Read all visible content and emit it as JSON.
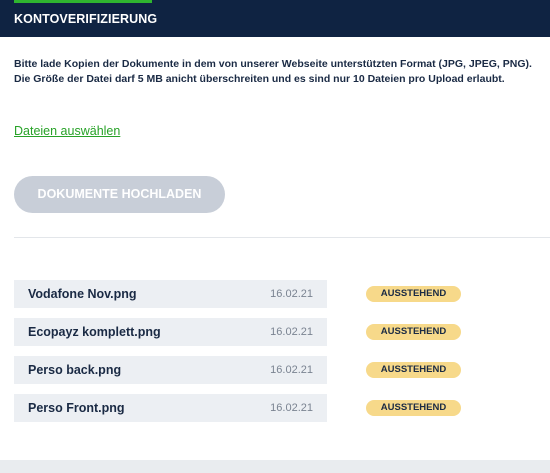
{
  "header": {
    "title": "KONTOVERIFIZIERUNG",
    "accent_color": "#2fb52f",
    "background_color": "#0f2342"
  },
  "info": {
    "line1": "Bitte lade Kopien der Dokumente in dem von unserer Webseite unterstützten Format (JPG, JPEG, PNG).",
    "line2": "Die Größe der Datei darf 5 MB anicht überschreiten und es sind nur 10 Dateien pro Upload erlaubt."
  },
  "select_files_label": "Dateien auswählen",
  "upload_button_label": "DOKUMENTE HOCHLADEN",
  "files": [
    {
      "name": "Vodafone Nov.png",
      "date": "16.02.21",
      "status": "AUSSTEHEND"
    },
    {
      "name": "Ecopayz komplett.png",
      "date": "16.02.21",
      "status": "AUSSTEHEND"
    },
    {
      "name": "Perso back.png",
      "date": "16.02.21",
      "status": "AUSSTEHEND"
    },
    {
      "name": "Perso Front.png",
      "date": "16.02.21",
      "status": "AUSSTEHEND"
    }
  ],
  "status_badge_color": "#f7d98a"
}
